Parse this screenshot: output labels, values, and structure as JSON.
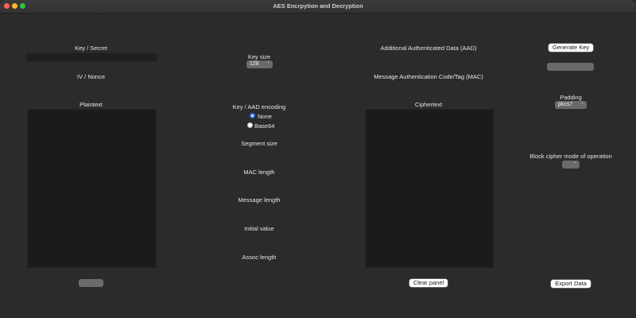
{
  "window": {
    "title": "AES Encrpytion and Decryption"
  },
  "labels": {
    "key_secret": "Key / Secret",
    "iv_nonce": "IV / Nonce",
    "plaintext": "Plaintext",
    "key_size": "Key size",
    "key_aad_encoding": "Key / AAD encoding",
    "segment_size": "Segment size",
    "mac_length": "MAC length",
    "message_length": "Message length",
    "initial_value": "Initial value",
    "assoc_length": "Assoc length",
    "aad": "Additional Authenticated Data (AAD)",
    "mac": "Message Authentication Code/Tag (MAC)",
    "ciphertext": "Ciphertext",
    "padding": "Padding",
    "block_mode": "Block cipher mode of operation"
  },
  "selects": {
    "key_size": "128",
    "padding": "pkcs7",
    "block_mode": ""
  },
  "encoding": {
    "options": [
      "None",
      "Base64"
    ],
    "selected": "None"
  },
  "buttons": {
    "generate_key": "Generate Key",
    "clear_panel": "Clear panel",
    "export_data": "Export Data"
  }
}
